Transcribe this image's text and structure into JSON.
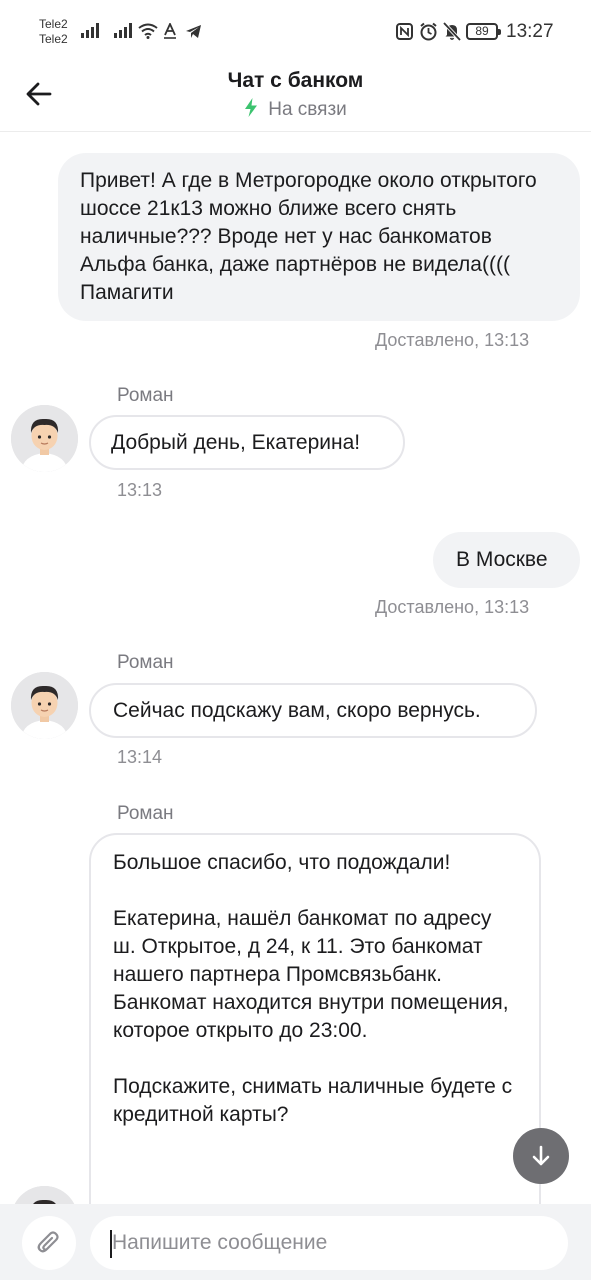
{
  "status_bar": {
    "carrier_1": "Tele2",
    "carrier_2": "Tele2",
    "battery": "89",
    "time": "13:27"
  },
  "header": {
    "title": "Чат с банком",
    "subtitle": "На связи",
    "online_color": "#3cc36f"
  },
  "messages": [
    {
      "direction": "out",
      "text": "Привет! А где в Метрогородке около открытого шоссе 21к13 можно ближе всего снять наличные??? Вроде нет у нас банкоматов Альфа банка, даже партнёров не видела(((( Памагити",
      "status": "Доставлено, 13:13"
    },
    {
      "direction": "in",
      "sender": "Роман",
      "text": "Добрый день, Екатерина!",
      "time": "13:13"
    },
    {
      "direction": "out",
      "text": "В Москве",
      "status": "Доставлено, 13:13"
    },
    {
      "direction": "in",
      "sender": "Роман",
      "text": "Сейчас подскажу вам, скоро вернусь.",
      "time": "13:14"
    },
    {
      "direction": "in",
      "sender": "Роман",
      "text": "Большое спасибо, что подождали!\n\nЕкатерина, нашёл банкомат по адресу ш. Открытое, д 24, к 11. Это банкомат нашего партнера Промсвязьбанк.\nБанкомат находится внутри помещения, которое открыто до 23:00.\n\nПодскажите, снимать наличные будете с кредитной карты?"
    }
  ],
  "composer": {
    "placeholder": "Напишите сообщение"
  },
  "icons": {
    "back": "arrow-left-icon",
    "online": "lightning-icon",
    "attach": "paperclip-icon",
    "scroll_down": "arrow-down-icon"
  }
}
